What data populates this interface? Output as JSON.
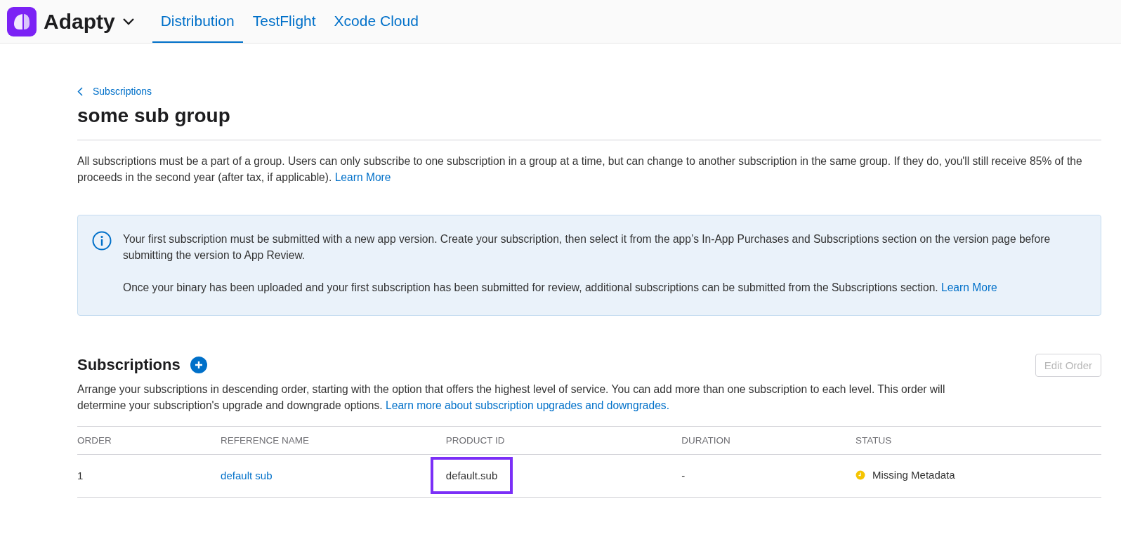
{
  "header": {
    "app_name": "Adapty",
    "tabs": [
      {
        "label": "Distribution",
        "selected": true
      },
      {
        "label": "TestFlight",
        "selected": false
      },
      {
        "label": "Xcode Cloud",
        "selected": false
      }
    ]
  },
  "breadcrumb": "Subscriptions",
  "title": "some sub group",
  "intro": {
    "text": "All subscriptions must be a part of a group. Users can only subscribe to one subscription in a group at a time, but can change to another subscription in the same group. If they do, you'll still receive 85% of the proceeds in the second year (after tax, if applicable).",
    "link": "Learn More"
  },
  "notice": {
    "paragraphs": [
      {
        "text": "Your first subscription must be submitted with a new app version. Create your subscription, then select it from the app’s In-App Purchases and Subscriptions section on the version page before submitting the version to App Review."
      },
      {
        "text": "Once your binary has been uploaded and your first subscription has been submitted for review, additional subscriptions can be submitted from the Subscriptions section.",
        "link": "Learn More"
      }
    ]
  },
  "subscriptions": {
    "title": "Subscriptions",
    "edit_button": {
      "label": "Edit Order",
      "disabled": true
    },
    "description": {
      "text": "Arrange your subscriptions in descending order, starting with the option that offers the highest level of service. You can add more than one subscription to each level. This order will determine your subscription's upgrade and downgrade options.",
      "link": "Learn more about subscription upgrades and downgrades."
    },
    "table": {
      "columns": [
        "ORDER",
        "REFERENCE NAME",
        "PRODUCT ID",
        "DURATION",
        "STATUS"
      ],
      "rows": [
        {
          "order": "1",
          "reference_name": "default sub",
          "product_id": "default.sub",
          "product_id_highlighted": true,
          "duration": "-",
          "status": "Missing Metadata",
          "color": "#f5c400"
        }
      ]
    }
  }
}
